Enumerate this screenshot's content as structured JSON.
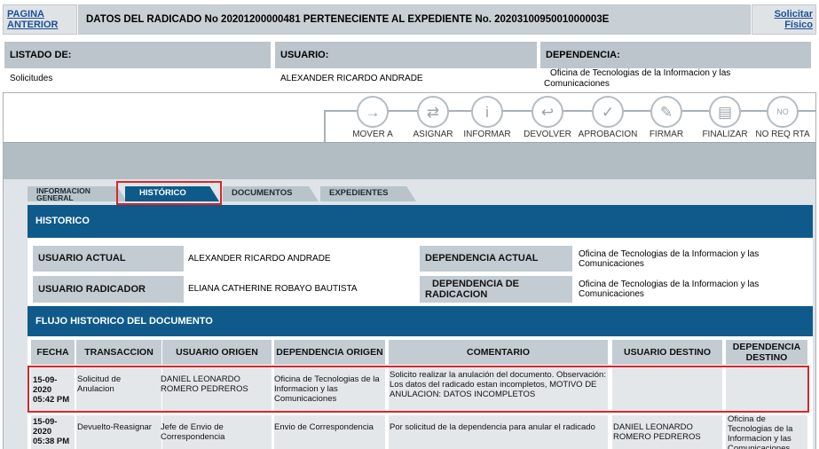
{
  "topbar": {
    "back_link": "PAGINA ANTERIOR",
    "title": "DATOS DEL RADICADO No 20201200000481   PERTENECIENTE AL EXPEDIENTE No. 2020310095001000003E",
    "request_physical_link": "Solicitar Físico"
  },
  "info": {
    "listado_label": "LISTADO DE:",
    "listado_value": "Solicitudes",
    "usuario_label": "USUARIO:",
    "usuario_value": "ALEXANDER RICARDO ANDRADE",
    "dependencia_label": "DEPENDENCIA:",
    "dependencia_value": "Oficina de Tecnologias de la Informacion y las Comunicaciones"
  },
  "actions": [
    {
      "label": "MOVER A",
      "icon": "arrow-right-icon",
      "glyph": "→"
    },
    {
      "label": "ASIGNAR",
      "icon": "assign-icon",
      "glyph": "⇄"
    },
    {
      "label": "INFORMAR",
      "icon": "info-icon",
      "glyph": "i"
    },
    {
      "label": "DEVOLVER",
      "icon": "return-icon",
      "glyph": "↩"
    },
    {
      "label": "APROBACION",
      "icon": "checkmark-icon",
      "glyph": "✓"
    },
    {
      "label": "FIRMAR",
      "icon": "signature-icon",
      "glyph": "✎"
    },
    {
      "label": "FINALIZAR",
      "icon": "finalize-icon",
      "glyph": "▤"
    },
    {
      "label": "NO REQ RTA",
      "icon": "no-response-icon",
      "glyph": "NO"
    }
  ],
  "tabs": {
    "info_general_line1": "INFORMACION",
    "info_general_line2": "GENERAL",
    "historico": "HISTÓRICO",
    "documentos": "DOCUMENTOS",
    "expedientes": "EXPEDIENTES"
  },
  "historico": {
    "header": "HISTORICO",
    "usuario_actual_label": "USUARIO ACTUAL",
    "usuario_actual_value": "ALEXANDER RICARDO ANDRADE",
    "dependencia_actual_label": "DEPENDENCIA ACTUAL",
    "dependencia_actual_value": "Oficina de Tecnologias de la Informacion y las Comunicaciones",
    "usuario_radicador_label": "USUARIO RADICADOR",
    "usuario_radicador_value": "ELIANA CATHERINE ROBAYO BAUTISTA",
    "dependencia_radicacion_label": "DEPENDENCIA DE RADICACION",
    "dependencia_radicacion_value": "Oficina de Tecnologias de la Informacion y las Comunicaciones"
  },
  "flujo": {
    "header": "FLUJO HISTORICO DEL DOCUMENTO",
    "columns": [
      "FECHA",
      "TRANSACCION",
      "USUARIO ORIGEN",
      "DEPENDENCIA ORIGEN",
      "COMENTARIO",
      "USUARIO DESTINO",
      "DEPENDENCIA DESTINO"
    ],
    "rows": [
      {
        "fecha": "15-09-2020 05:42 PM",
        "transaccion": "Solicitud de Anulacion",
        "usuario_origen": "DANIEL LEONARDO ROMERO PEDREROS",
        "dependencia_origen": "Oficina de Tecnologias de la Informacion y las Comunicaciones",
        "comentario": "Solicito realizar la anulación del documento. Observación: Los datos del radicado estan incompletos, MOTIVO DE ANULACION: DATOS INCOMPLETOS",
        "usuario_destino": "",
        "dependencia_destino": ""
      },
      {
        "fecha": "15-09-2020 05:38 PM",
        "transaccion": "Devuelto-Reasignar",
        "usuario_origen": "Jefe de Envio de Correspondencia",
        "dependencia_origen": "Envio de Correspondencia",
        "comentario": "Por solicitud de la dependencia para anular el radicado",
        "usuario_destino": "DANIEL LEONARDO ROMERO PEDREROS",
        "dependencia_destino": "Oficina de Tecnologias de la Informacion y las Comunicaciones"
      }
    ]
  }
}
